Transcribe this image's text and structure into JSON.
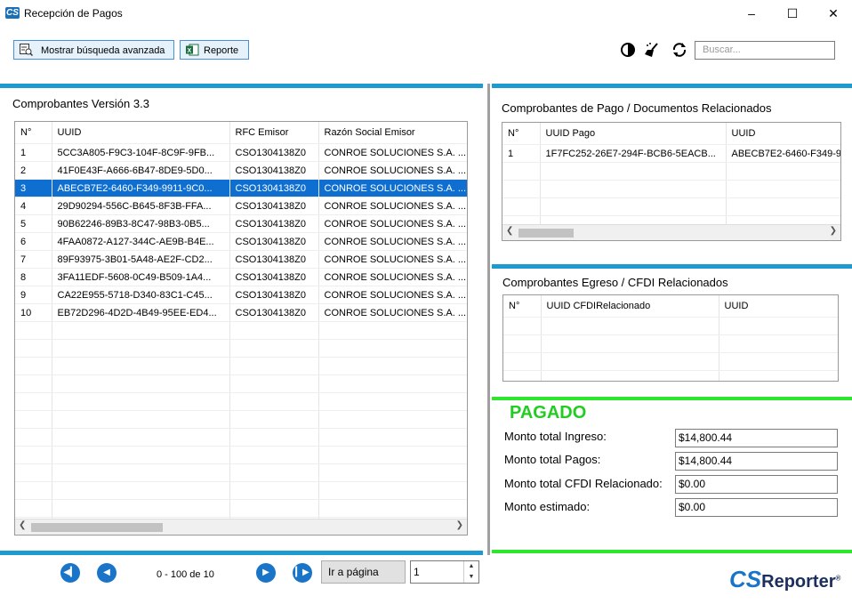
{
  "window": {
    "title": "Recepción de Pagos",
    "logo": "CS",
    "minimize": "–",
    "maximize": "☐",
    "close": "✕"
  },
  "toolbar": {
    "advanced_search": "Mostrar búsqueda avanzada",
    "report": "Reporte",
    "search_placeholder": "Buscar..."
  },
  "main_panel": {
    "title": "Comprobantes Versión 3.3",
    "columns": [
      "N°",
      "UUID",
      "RFC Emisor",
      "Razón Social Emisor"
    ],
    "rows": [
      [
        "1",
        "5CC3A805-F9C3-104F-8C9F-9FB...",
        "CSO1304138Z0",
        "CONROE SOLUCIONES S.A. ..."
      ],
      [
        "2",
        "41F0E43F-A666-6B47-8DE9-5D0...",
        "CSO1304138Z0",
        "CONROE SOLUCIONES S.A. ..."
      ],
      [
        "3",
        "ABECB7E2-6460-F349-9911-9C0...",
        "CSO1304138Z0",
        "CONROE SOLUCIONES S.A. ..."
      ],
      [
        "4",
        "29D90294-556C-B645-8F3B-FFA...",
        "CSO1304138Z0",
        "CONROE SOLUCIONES S.A. ..."
      ],
      [
        "5",
        "90B62246-89B3-8C47-98B3-0B5...",
        "CSO1304138Z0",
        "CONROE SOLUCIONES S.A. ..."
      ],
      [
        "6",
        "4FAA0872-A127-344C-AE9B-B4E...",
        "CSO1304138Z0",
        "CONROE SOLUCIONES S.A. ..."
      ],
      [
        "7",
        "89F93975-3B01-5A48-AE2F-CD2...",
        "CSO1304138Z0",
        "CONROE SOLUCIONES S.A. ..."
      ],
      [
        "8",
        "3FA11EDF-5608-0C49-B509-1A4...",
        "CSO1304138Z0",
        "CONROE SOLUCIONES S.A. ..."
      ],
      [
        "9",
        "CA22E955-5718-D340-83C1-C45...",
        "CSO1304138Z0",
        "CONROE SOLUCIONES S.A. ..."
      ],
      [
        "10",
        "EB72D296-4D2D-4B49-95EE-ED4...",
        "CSO1304138Z0",
        "CONROE SOLUCIONES S.A. ..."
      ]
    ],
    "selected_row": 2
  },
  "payments_panel": {
    "title": "Comprobantes de Pago / Documentos Relacionados",
    "columns": [
      "N°",
      "UUID Pago",
      "UUID"
    ],
    "rows": [
      [
        "1",
        "1F7FC252-26E7-294F-BCB6-5EACB...",
        "ABECB7E2-6460-F349-9"
      ]
    ]
  },
  "egress_panel": {
    "title": "Comprobantes Egreso / CFDI Relacionados",
    "columns": [
      "N°",
      "UUID  CFDIRelacionado",
      "UUID"
    ],
    "rows": []
  },
  "totals": {
    "status": "PAGADO",
    "status_color": "#22cc22",
    "ingreso_label": "Monto total Ingreso:",
    "ingreso_value": "$14,800.44",
    "pagos_label": "Monto total Pagos:",
    "pagos_value": "$14,800.44",
    "cfdi_label": "Monto total CFDI Relacionado:",
    "cfdi_value": "$0.00",
    "estimado_label": "Monto estimado:",
    "estimado_value": "$0.00"
  },
  "pager": {
    "info": "0 - 100 de 10",
    "goto_label": "Ir a página",
    "page_value": "1"
  },
  "brand": {
    "cs": "CS",
    "name": "Reporter",
    "mark": "®"
  },
  "colors": {
    "accent_blue": "#1d9bd1",
    "accent_green": "#2ee62e",
    "selection": "#0f6fd1"
  }
}
